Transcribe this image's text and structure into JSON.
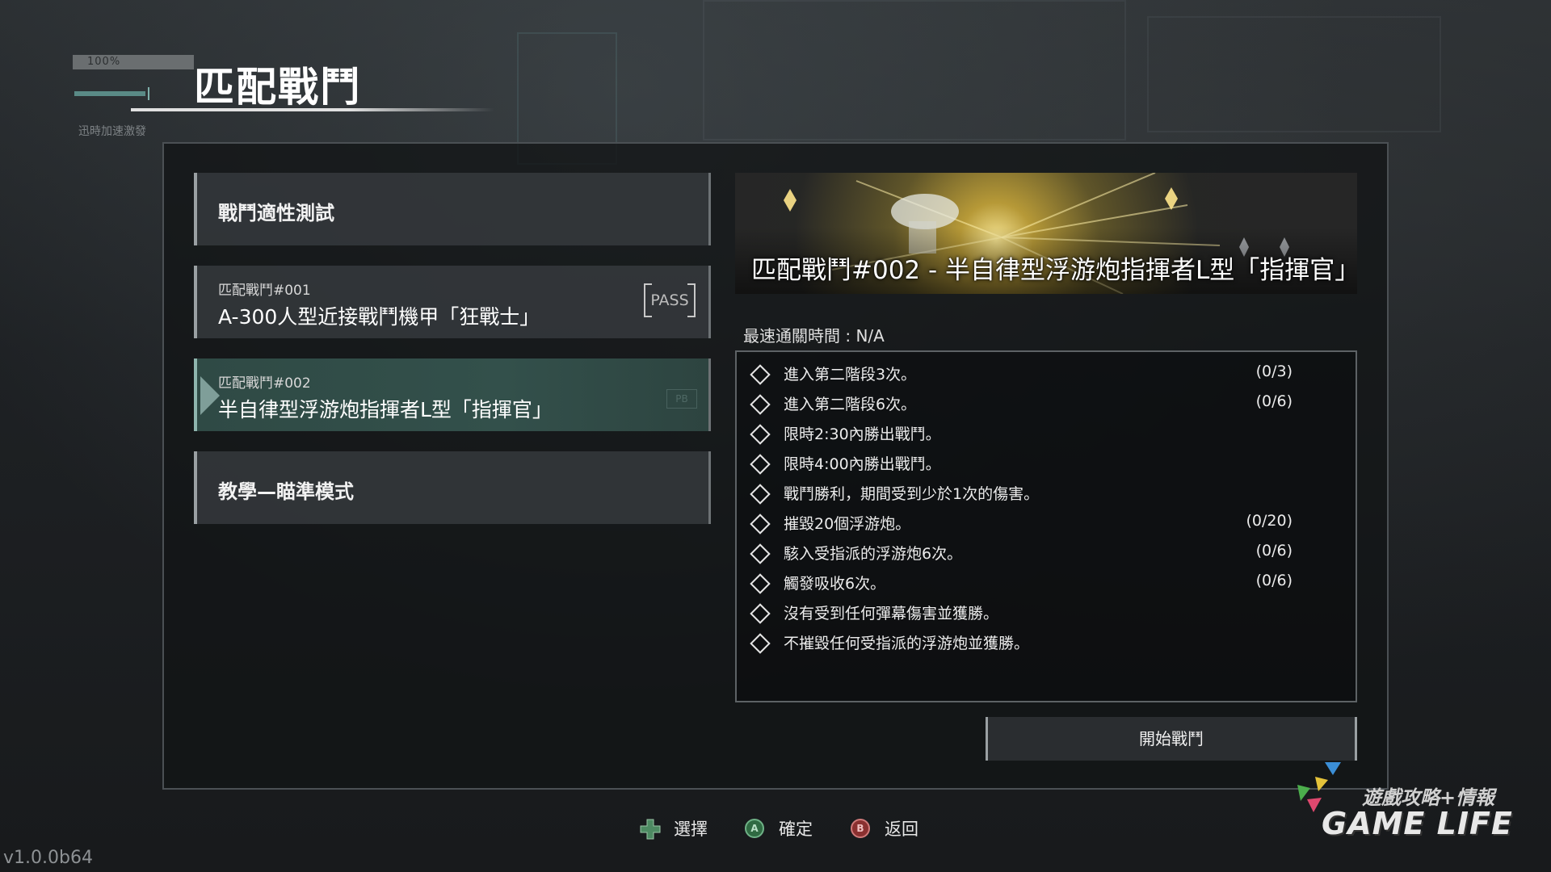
{
  "header": {
    "progress_label": "100%",
    "title": "匹配戰鬥",
    "subtitle": "迅時加速激發"
  },
  "menu": {
    "items": [
      {
        "label": "戰鬥適性測試"
      },
      {
        "sublabel": "匹配戰鬥#001",
        "label": "A-300人型近接戰鬥機甲「狂戰士」",
        "badge": "PASS"
      },
      {
        "sublabel": "匹配戰鬥#002",
        "label": "半自律型浮游炮指揮者L型「指揮官」",
        "badge_hint": "PB"
      },
      {
        "label": "教學—瞄準模式"
      }
    ],
    "selected_index": 2
  },
  "detail": {
    "banner_title": "匹配戰鬥#002 - 半自律型浮游炮指揮者L型「指揮官」",
    "best_time": "最速通關時間 : N/A",
    "challenges": [
      {
        "text": "進入第二階段3次。",
        "count": "(0/3)"
      },
      {
        "text": "進入第二階段6次。",
        "count": "(0/6)"
      },
      {
        "text": "限時2:30內勝出戰鬥。",
        "count": ""
      },
      {
        "text": "限時4:00內勝出戰鬥。",
        "count": ""
      },
      {
        "text": "戰鬥勝利，期間受到少於1次的傷害。",
        "count": ""
      },
      {
        "text": "摧毀20個浮游炮。",
        "count": "(0/20)"
      },
      {
        "text": "駭入受指派的浮游炮6次。",
        "count": "(0/6)"
      },
      {
        "text": "觸發吸收6次。",
        "count": "(0/6)"
      },
      {
        "text": "沒有受到任何彈幕傷害並獲勝。",
        "count": ""
      },
      {
        "text": "不摧毀任何受指派的浮游炮並獲勝。",
        "count": ""
      }
    ],
    "start_button": "開始戰鬥"
  },
  "controls": {
    "select": {
      "icon": "dpad-icon",
      "label": "選擇"
    },
    "confirm": {
      "icon": "a-button-icon",
      "glyph": "A",
      "label": "確定"
    },
    "back": {
      "icon": "b-button-icon",
      "glyph": "B",
      "label": "返回"
    }
  },
  "version": "v1.0.0b64",
  "watermark": {
    "line1": "遊戲攻略+情報",
    "line2": "GAME LIFE"
  },
  "colors": {
    "selected_item": "#33504b",
    "accent_teal": "#5a8a86",
    "panel_border": "#4b5054",
    "a_button": "#3e8a54",
    "b_button": "#b44646"
  }
}
